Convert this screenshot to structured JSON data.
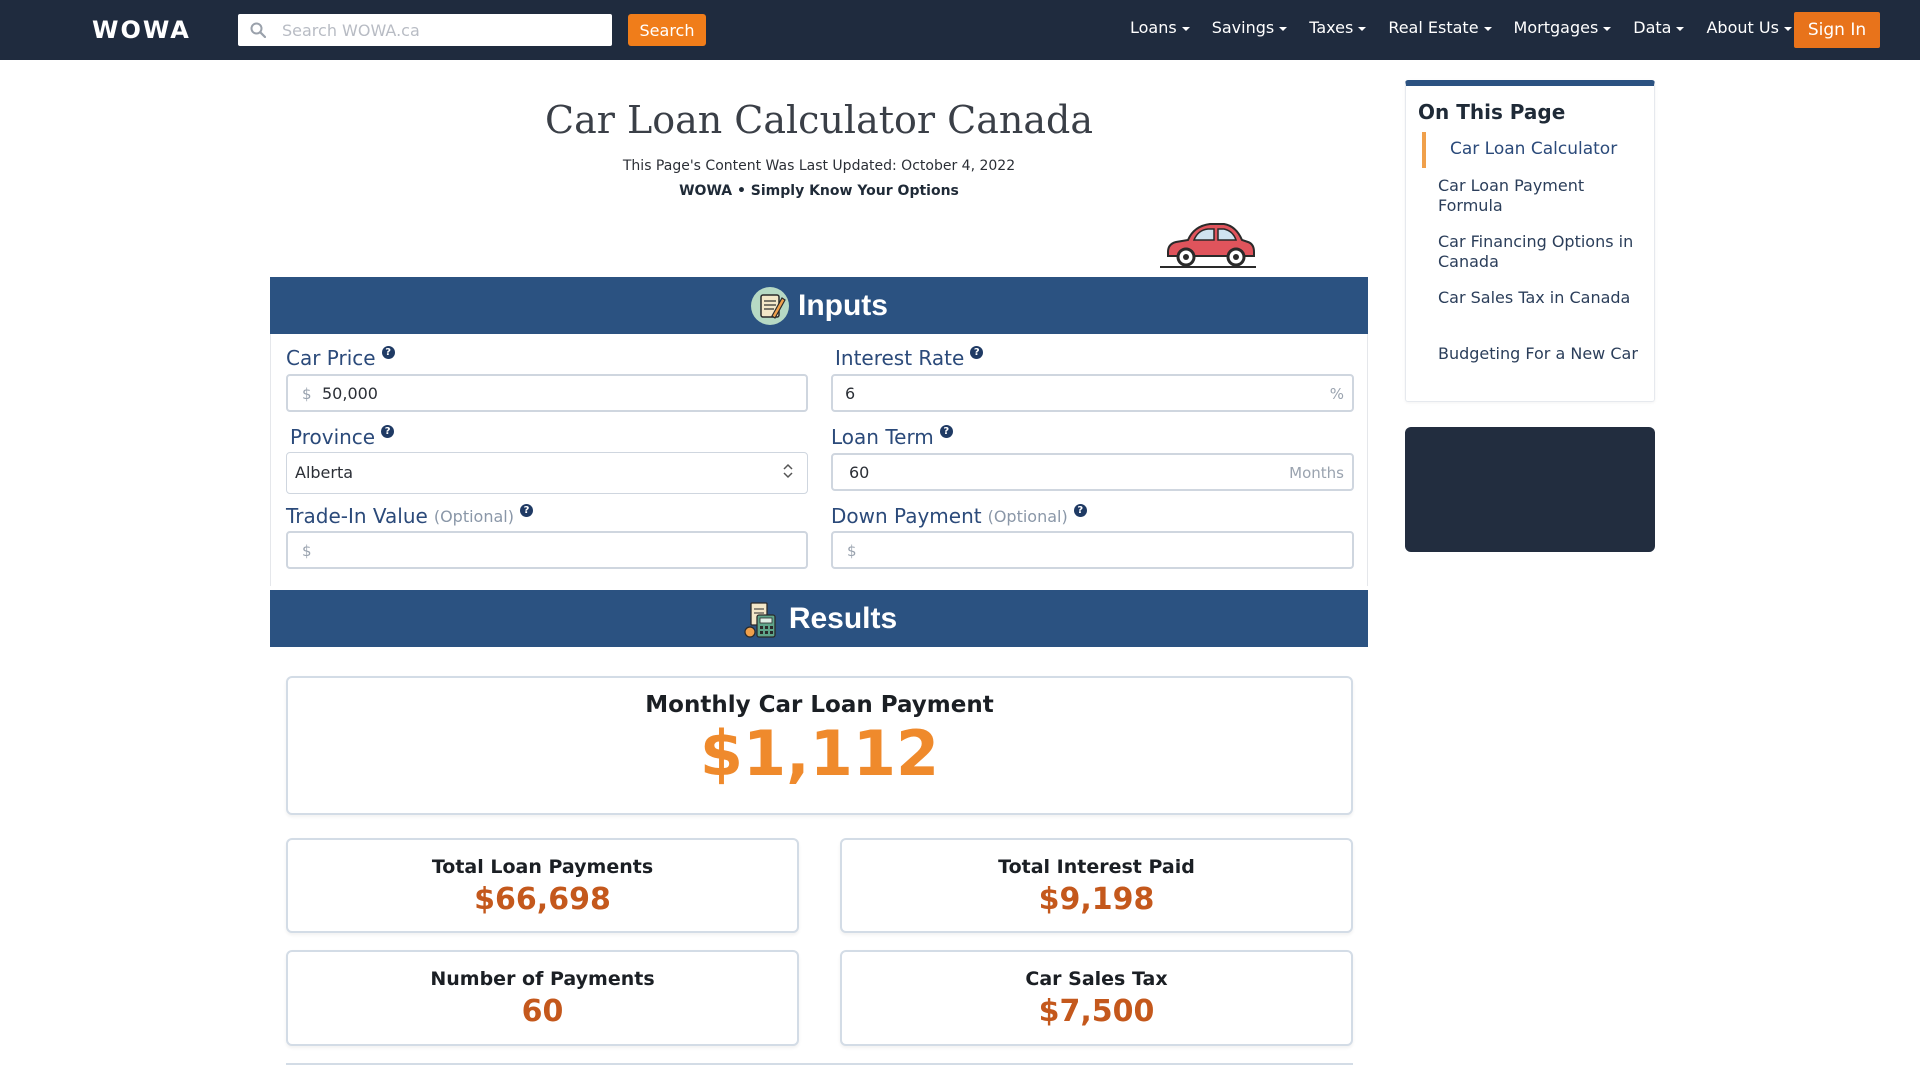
{
  "header": {
    "logo": "WOWA",
    "search_placeholder": "Search WOWA.ca",
    "search_button": "Search",
    "nav": [
      "Loans",
      "Savings",
      "Taxes",
      "Real Estate",
      "Mortgages",
      "Data",
      "About Us"
    ],
    "signin": "Sign In"
  },
  "page": {
    "title": "Car Loan Calculator Canada",
    "updated": "This Page's Content Was Last Updated: October 4, 2022",
    "tagline": "WOWA • Simply Know Your Options"
  },
  "inputs": {
    "section_title": "Inputs",
    "car_price": {
      "label": "Car Price",
      "prefix": "$",
      "value": "50,000"
    },
    "interest_rate": {
      "label": "Interest Rate",
      "value": "6",
      "suffix": "%"
    },
    "province": {
      "label": "Province",
      "value": "Alberta"
    },
    "loan_term": {
      "label": "Loan Term",
      "value": "60",
      "suffix": "Months"
    },
    "trade_in": {
      "label": "Trade-In Value",
      "optional": "(Optional)",
      "prefix": "$",
      "value": ""
    },
    "down_payment": {
      "label": "Down Payment",
      "optional": "(Optional)",
      "prefix": "$",
      "value": ""
    }
  },
  "results": {
    "section_title": "Results",
    "monthly": {
      "label": "Monthly Car Loan Payment",
      "value": "$1,112"
    },
    "total_payments": {
      "label": "Total Loan Payments",
      "value": "$66,698"
    },
    "total_interest": {
      "label": "Total Interest Paid",
      "value": "$9,198"
    },
    "num_payments": {
      "label": "Number of Payments",
      "value": "60"
    },
    "sales_tax": {
      "label": "Car Sales Tax",
      "value": "$7,500"
    }
  },
  "toc": {
    "title": "On This Page",
    "items": [
      "Car Loan Calculator",
      "Car Loan Payment Formula",
      "Car Financing Options in Canada",
      "Car Sales Tax in Canada",
      "Budgeting For a New Car"
    ]
  },
  "colors": {
    "nav_bg": "#1f2b3e",
    "accent_orange": "#f07d1a",
    "section_blue": "#2b5281",
    "result_orange": "#c4581c"
  }
}
